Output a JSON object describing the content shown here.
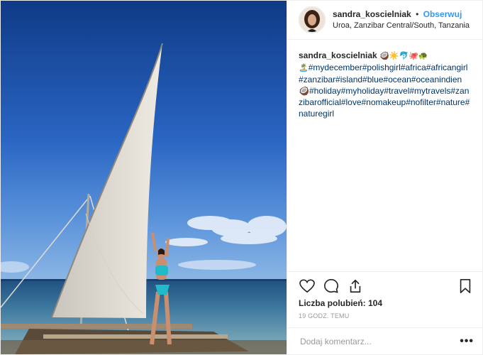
{
  "post": {
    "username": "sandra_koscielniak",
    "separator": "•",
    "follow_label": "Obserwuj",
    "location": "Uroa, Zanzibar Central/South, Tanzania"
  },
  "caption": {
    "username": "sandra_koscielniak",
    "emojis_line1": "🥥☀️🐬🐙🐢",
    "emoji_palm": "🏝️",
    "hashtags": "#mydecember#polishgirl#africa#africangirl#zanzibar#island#blue#ocean#oceanindien🥥#holiday#myholiday#travel#mytravels#zanzibarofficial#love#nomakeup#nofilter#nature#naturegirl"
  },
  "actions": {
    "likes_text": "Liczba polubień: 104",
    "timestamp": "19 GODZ. TEMU"
  },
  "comment": {
    "placeholder": "Dodaj komentarz...",
    "more_label": "•••"
  },
  "icons": {
    "like": "heart-icon",
    "comment": "comment-icon",
    "share": "share-icon",
    "save": "bookmark-icon",
    "more": "more-options-icon"
  },
  "colors": {
    "follow": "#3897f0",
    "text": "#262626",
    "muted": "#999999",
    "border": "#efefef"
  }
}
